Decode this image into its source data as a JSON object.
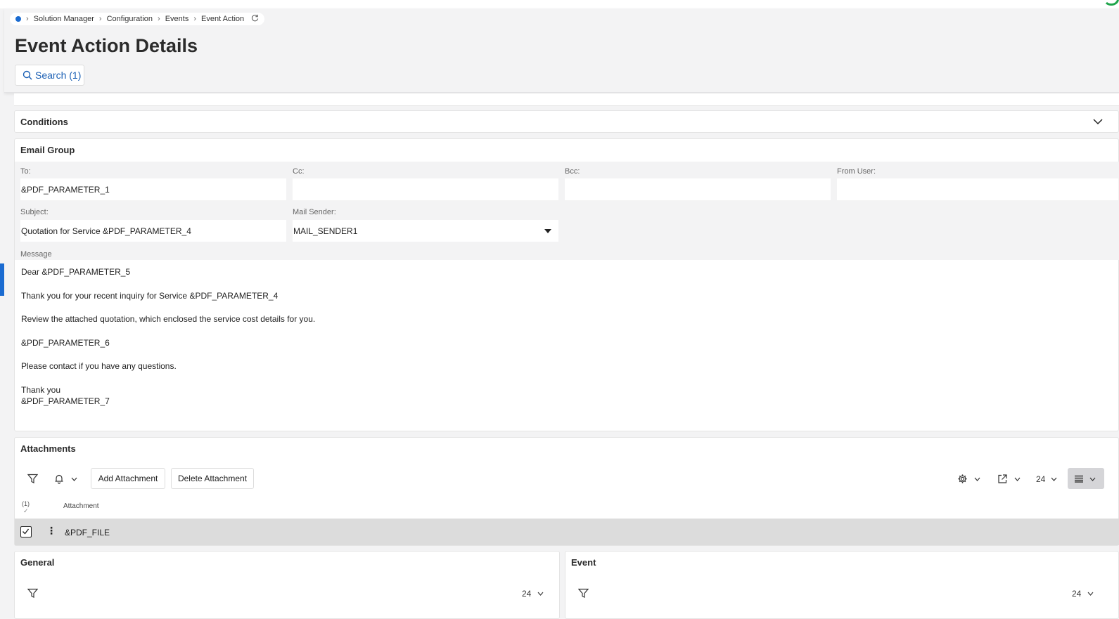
{
  "breadcrumb": {
    "items": [
      "Solution Manager",
      "Configuration",
      "Events",
      "Event Action"
    ]
  },
  "page": {
    "title": "Event Action Details",
    "search_label": "Search (1)"
  },
  "conditions": {
    "title": "Conditions"
  },
  "email_group": {
    "title": "Email Group",
    "to_label": "To:",
    "to_value": "&PDF_PARAMETER_1",
    "cc_label": "Cc:",
    "cc_value": "",
    "bcc_label": "Bcc:",
    "bcc_value": "",
    "from_user_label": "From User:",
    "from_user_value": "",
    "subject_label": "Subject:",
    "subject_value": "Quotation for Service &PDF_PARAMETER_4",
    "mail_sender_label": "Mail Sender:",
    "mail_sender_value": "MAIL_SENDER1",
    "message_label": "Message",
    "message_lines": [
      "Dear &PDF_PARAMETER_5",
      "Thank you for your recent inquiry for Service &PDF_PARAMETER_4",
      "Review the attached quotation, which enclosed the service cost details for you.",
      "&PDF_PARAMETER_6",
      "Please contact if you have any questions.",
      "Thank you",
      "&PDF_PARAMETER_7"
    ]
  },
  "attachments": {
    "title": "Attachments",
    "add_label": "Add Attachment",
    "delete_label": "Delete Attachment",
    "page_size": "24",
    "selected_count": "(1)",
    "column_header": "Attachment",
    "rows": [
      {
        "attachment": "&PDF_FILE"
      }
    ]
  },
  "general": {
    "title": "General",
    "page_size": "24"
  },
  "event": {
    "title": "Event",
    "page_size": "24"
  },
  "colors": {
    "accent": "#1a6bd1",
    "link": "#1a5fb4",
    "selected_row": "#dcdcdc",
    "page_bg": "#f3f3f4"
  },
  "icons": [
    "search-icon",
    "refresh-icon",
    "chevron-down-icon",
    "filter-icon",
    "bell-icon",
    "gear-icon",
    "export-icon",
    "list-view-icon",
    "kebab-icon",
    "checkbox-icon"
  ]
}
